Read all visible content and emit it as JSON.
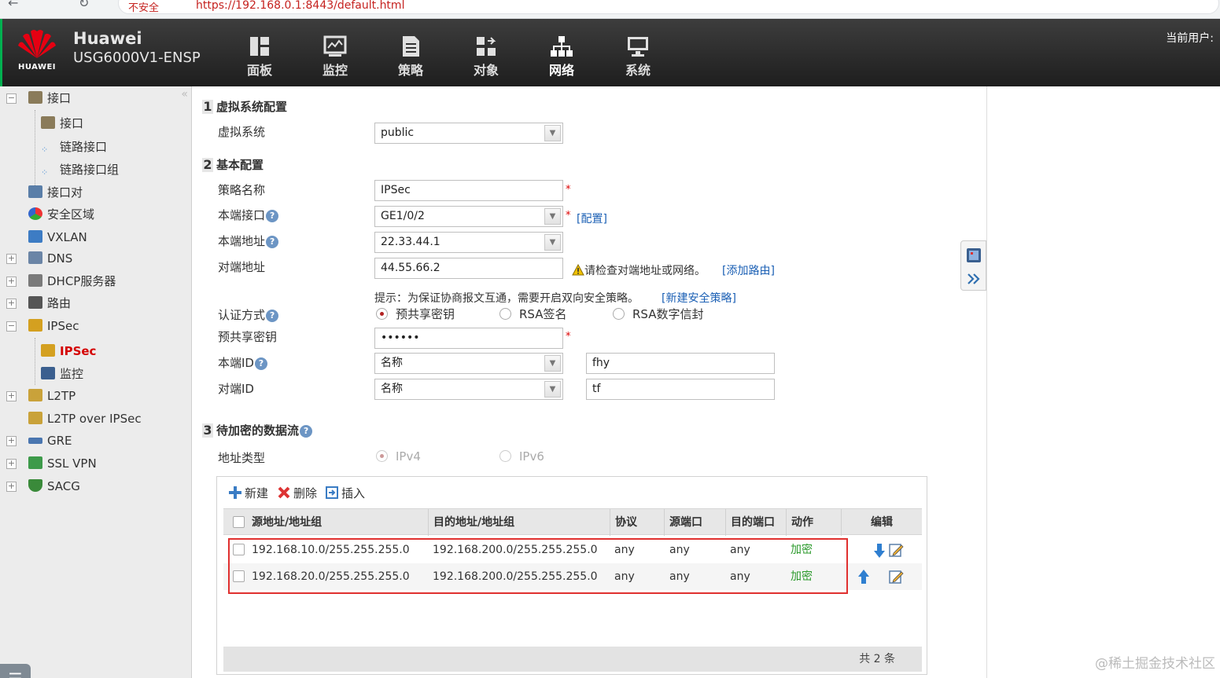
{
  "browser": {
    "security": "不安全",
    "url": "https://192.168.0.1:8443/default.html"
  },
  "header": {
    "brand_logo_text": "HUAWEI",
    "brand_name": "Huawei",
    "model": "USG6000V1-ENSP",
    "current_user_label": "当前用户:",
    "nav": [
      {
        "label": "面板",
        "icon": "dashboard-icon"
      },
      {
        "label": "监控",
        "icon": "monitor-icon"
      },
      {
        "label": "策略",
        "icon": "policy-icon"
      },
      {
        "label": "对象",
        "icon": "object-icon"
      },
      {
        "label": "网络",
        "icon": "network-icon",
        "active": true
      },
      {
        "label": "系统",
        "icon": "system-icon"
      }
    ]
  },
  "sidebar": {
    "collapse_glyph": "«",
    "items": [
      {
        "label": "接口",
        "icon": "interface-icon",
        "expanded": true
      },
      {
        "label": "接口",
        "icon": "interface-icon"
      },
      {
        "label": "链路接口",
        "icon": "link-interface-icon"
      },
      {
        "label": "链路接口组",
        "icon": "link-interface-group-icon"
      },
      {
        "label": "接口对",
        "icon": "interface-pair-icon"
      },
      {
        "label": "安全区域",
        "icon": "security-zone-icon"
      },
      {
        "label": "VXLAN",
        "icon": "vxlan-icon"
      },
      {
        "label": "DNS",
        "icon": "dns-icon",
        "expandable": true
      },
      {
        "label": "DHCP服务器",
        "icon": "dhcp-server-icon",
        "expandable": true
      },
      {
        "label": "路由",
        "icon": "router-icon",
        "expandable": true
      },
      {
        "label": "IPSec",
        "icon": "ipsec-icon",
        "expanded": true
      },
      {
        "label": "IPSec",
        "icon": "ipsec-icon",
        "selected": true
      },
      {
        "label": "监控",
        "icon": "monitor-icon"
      },
      {
        "label": "L2TP",
        "icon": "l2tp-icon",
        "expandable": true
      },
      {
        "label": "L2TP over IPSec",
        "icon": "l2tp-over-ipsec-icon"
      },
      {
        "label": "GRE",
        "icon": "gre-icon",
        "expandable": true
      },
      {
        "label": "SSL VPN",
        "icon": "ssl-vpn-icon",
        "expandable": true
      },
      {
        "label": "SACG",
        "icon": "sacg-icon",
        "expandable": true
      }
    ],
    "menu_toggle_glyph": "☰"
  },
  "form": {
    "section1": {
      "num": "1",
      "title": "虚拟系统配置"
    },
    "vsys": {
      "label": "虚拟系统",
      "value": "public"
    },
    "section2": {
      "num": "2",
      "title": "基本配置"
    },
    "policy_name": {
      "label": "策略名称",
      "value": "IPSec"
    },
    "local_interface": {
      "label": "本端接口",
      "value": "GE1/0/2",
      "link": "[配置]"
    },
    "local_address": {
      "label": "本端地址",
      "value": "22.33.44.1"
    },
    "peer_address": {
      "label": "对端地址",
      "value": "44.55.66.2",
      "warning": "请检查对端地址或网络。",
      "link": "[添加路由]"
    },
    "hint": {
      "text": "提示：为保证协商报文互通，需要开启双向安全策略。",
      "link": "[新建安全策略]"
    },
    "auth": {
      "label": "认证方式",
      "options": [
        "预共享密钥",
        "RSA签名",
        "RSA数字信封"
      ],
      "selected": 0
    },
    "psk": {
      "label": "预共享密钥",
      "value": "••••••"
    },
    "local_id": {
      "label": "本端ID",
      "type": "名称",
      "value": "fhy"
    },
    "peer_id": {
      "label": "对端ID",
      "type": "名称",
      "value": "tf"
    },
    "required_mark": "*",
    "help_glyph": "?",
    "dropdown_glyph": "▼",
    "section3": {
      "num": "3",
      "title": "待加密的数据流"
    },
    "addr_type": {
      "label": "地址类型",
      "options": [
        "IPv4",
        "IPv6"
      ],
      "selected": 0
    }
  },
  "toolbar": {
    "new": "新建",
    "delete": "删除",
    "insert": "插入"
  },
  "table": {
    "columns": [
      "源地址/地址组",
      "目的地址/地址组",
      "协议",
      "源端口",
      "目的端口",
      "动作",
      "编辑"
    ],
    "rows": [
      {
        "src": "192.168.10.0/255.255.255.0",
        "dst": "192.168.200.0/255.255.255.0",
        "proto": "any",
        "sport": "any",
        "dport": "any",
        "action": "加密"
      },
      {
        "src": "192.168.20.0/255.255.255.0",
        "dst": "192.168.200.0/255.255.255.0",
        "proto": "any",
        "sport": "any",
        "dport": "any",
        "action": "加密"
      }
    ],
    "footer": "共 2 条"
  },
  "watermark": "@稀土掘金技术社区",
  "colors": {
    "accent_red": "#e0302f",
    "action_green": "#2c9a2c",
    "link_blue": "#1a5fb4",
    "header_dark": "#2a2a2a"
  }
}
